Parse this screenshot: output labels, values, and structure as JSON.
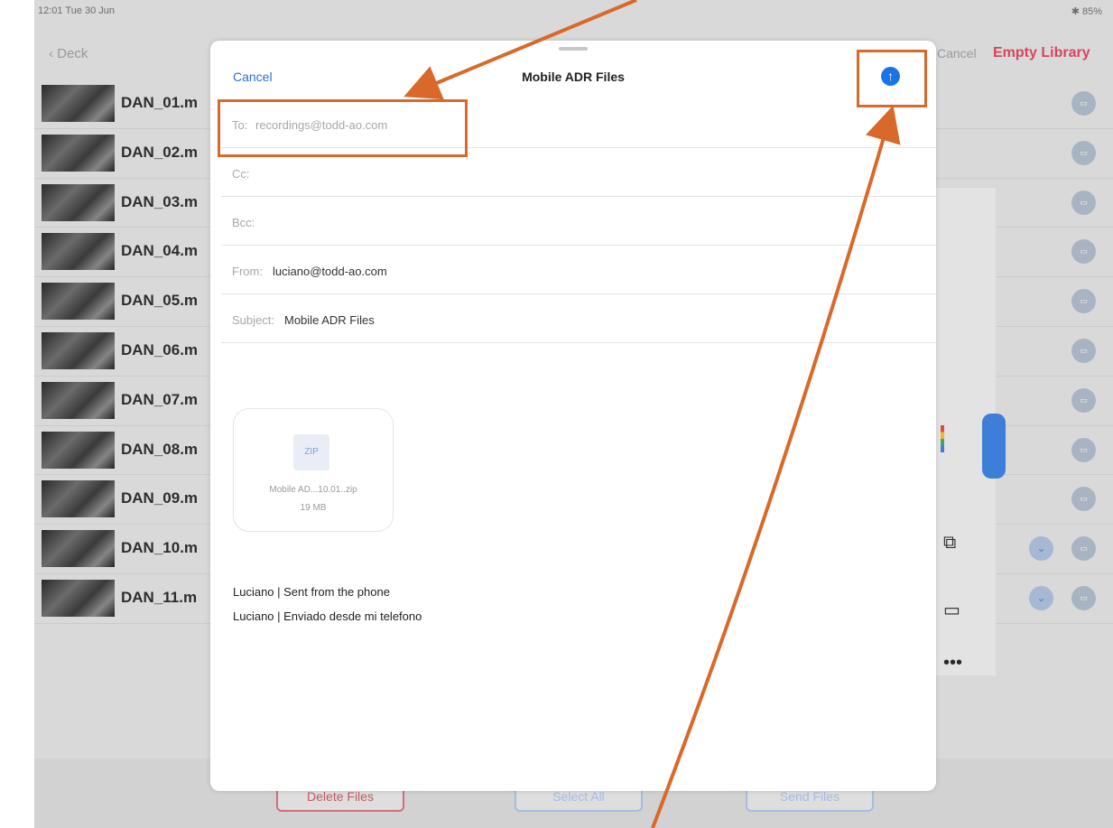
{
  "statusbar": {
    "time": "12:01 Tue 30 Jun",
    "battery": "✱ 85%"
  },
  "topbar": {
    "back_label": "Deck",
    "cancel_label": "Cancel",
    "empty_label": "Empty Library"
  },
  "files": [
    {
      "name": "DAN_01.m"
    },
    {
      "name": "DAN_02.m"
    },
    {
      "name": "DAN_03.m"
    },
    {
      "name": "DAN_04.m"
    },
    {
      "name": "DAN_05.m"
    },
    {
      "name": "DAN_06.m"
    },
    {
      "name": "DAN_07.m"
    },
    {
      "name": "DAN_08.m"
    },
    {
      "name": "DAN_09.m"
    },
    {
      "name": "DAN_10.m"
    },
    {
      "name": "DAN_11.m"
    }
  ],
  "bottombar": {
    "delete_label": "Delete Files",
    "select_label": "Select All",
    "send_label": "Send Files"
  },
  "mail": {
    "cancel_label": "Cancel",
    "title": "Mobile ADR Files",
    "to_label": "To:",
    "to_value": "recordings@todd-ao.com",
    "cc_label": "Cc:",
    "bcc_label": "Bcc:",
    "from_label": "From:",
    "from_value": "luciano@todd-ao.com",
    "subject_label": "Subject:",
    "subject_value": "Mobile ADR Files",
    "attachment": {
      "type": "ZIP",
      "name": "Mobile AD...10.01..zip",
      "size": "19 MB"
    },
    "body_lines": [
      "Luciano | Sent from the phone",
      "Luciano | Enviado desde mi telefono"
    ]
  },
  "colors": {
    "accent": "#1b73e8",
    "highlight": "#d9692a",
    "danger": "#d6455e"
  }
}
